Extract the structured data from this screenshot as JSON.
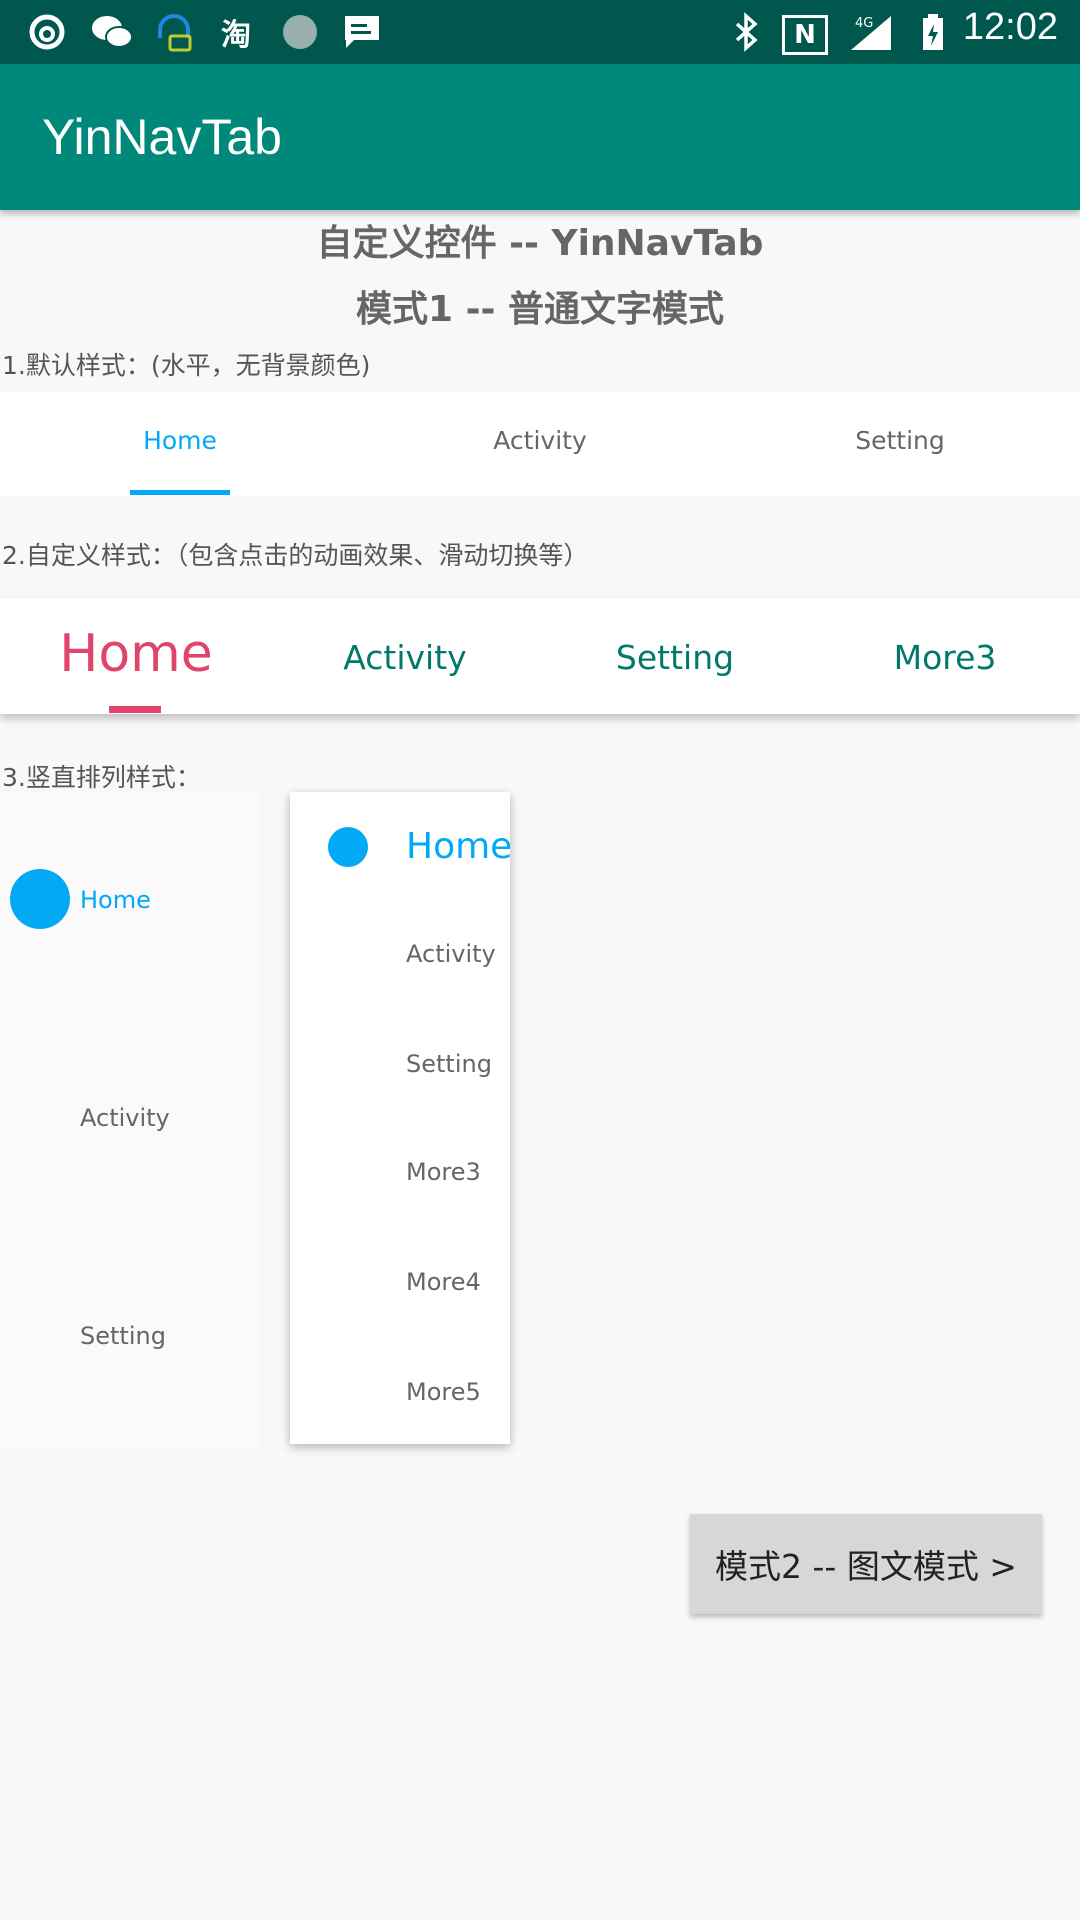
{
  "status_bar": {
    "icons": [
      "netease-music-icon",
      "wechat-icon",
      "headset-icon",
      "taobao-icon",
      "circle-app-icon",
      "message-icon",
      "bluetooth-icon",
      "nfc-icon",
      "signal-4g-icon",
      "battery-icon"
    ],
    "taobao_glyph": "淘",
    "network": "4G",
    "nfc": "N",
    "time": "12:02"
  },
  "app_bar": {
    "title": "YinNavTab"
  },
  "headings": {
    "title": "自定义控件 -- YinNavTab",
    "subtitle": "模式1 -- 普通文字模式"
  },
  "section1": {
    "label": "1.默认样式：(水平，无背景颜色)",
    "tabs": [
      "Home",
      "Activity",
      "Setting"
    ],
    "selected_index": 0,
    "selected_color": "#03a9f4"
  },
  "section2": {
    "label": "2.自定义样式：（包含点击的动画效果、滑动切换等）",
    "tabs": [
      "Home",
      "Activity",
      "Setting",
      "More3"
    ],
    "selected_index": 0,
    "selected_color": "#e0446a",
    "text_color": "#00796b"
  },
  "section3": {
    "label": "3.竖直排列样式：",
    "vertical_tabs_a": [
      "Home",
      "Activity",
      "Setting"
    ],
    "vertical_tabs_b": [
      "Home",
      "Activity",
      "Setting",
      "More3",
      "More4",
      "More5"
    ],
    "selected_index": 0
  },
  "mode2_button": {
    "label": "模式2 -- 图文模式 >"
  },
  "colors": {
    "status_bar": "#00574e",
    "app_bar": "#00897b",
    "accent_blue": "#03a9f4",
    "accent_pink": "#e0446a"
  }
}
